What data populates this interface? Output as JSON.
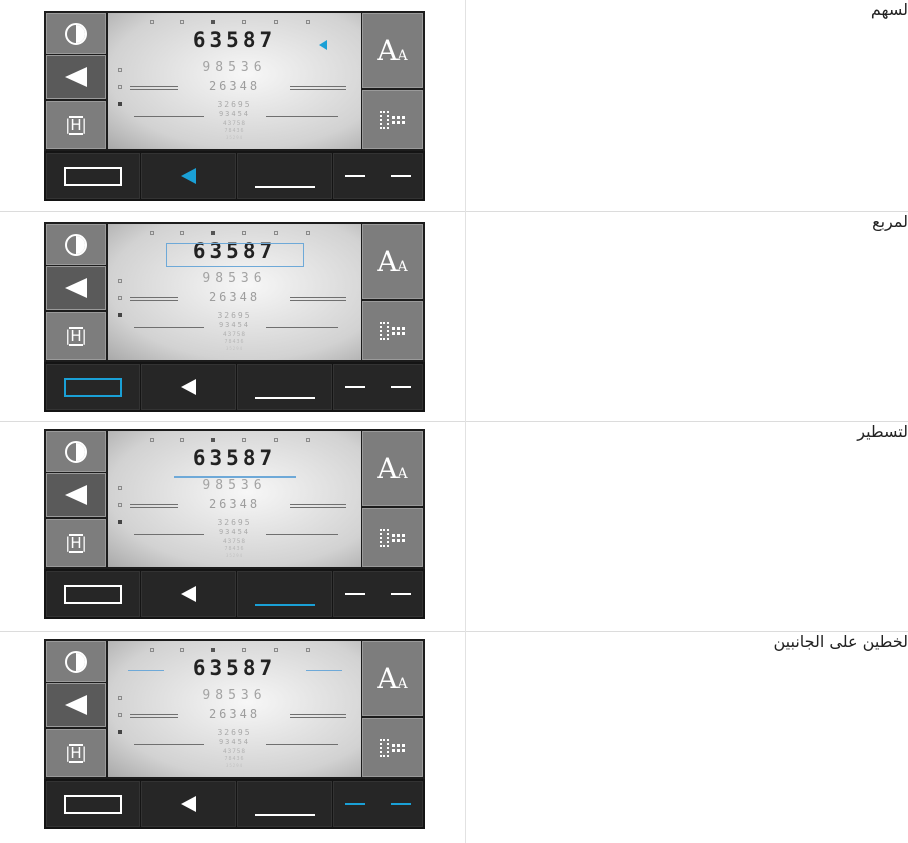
{
  "rows": [
    {
      "label": "لسهم",
      "highlight": "arrow"
    },
    {
      "label": "لمربع",
      "highlight": "box"
    },
    {
      "label": "لتسطير",
      "highlight": "underline"
    },
    {
      "label": "لخطين على الجانبين",
      "highlight": "side-lines"
    }
  ],
  "panel": {
    "font_button_label": "A",
    "font_button_small_label": "A",
    "chart_lines": [
      "63587",
      "98536",
      "26348",
      "32695",
      "93454",
      "43758",
      "78436",
      "35294"
    ]
  },
  "colors": {
    "accent_blue": "#1aa0d6",
    "panel_gray": "#7d7d7d",
    "bar_dark": "#262626"
  },
  "icons": [
    "contrast-icon",
    "left-arrow-icon",
    "h-bar-icon",
    "font-size-icon",
    "grid-dots-icon",
    "rectangle-icon",
    "arrow-icon",
    "underline-icon",
    "dashes-icon"
  ]
}
